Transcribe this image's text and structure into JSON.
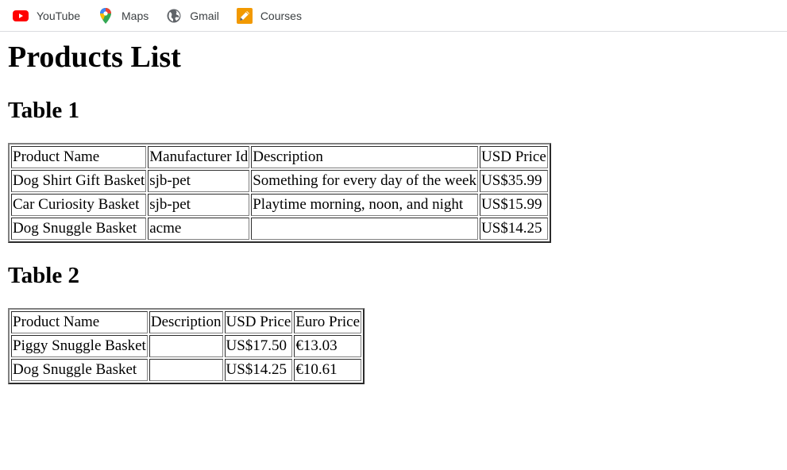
{
  "bookmarks": [
    {
      "label": "YouTube",
      "icon": "youtube-icon"
    },
    {
      "label": "Maps",
      "icon": "maps-icon"
    },
    {
      "label": "Gmail",
      "icon": "globe-icon"
    },
    {
      "label": "Courses",
      "icon": "pencil-icon"
    }
  ],
  "page": {
    "title": "Products List"
  },
  "table1": {
    "heading": "Table 1",
    "headers": [
      "Product Name",
      "Manufacturer Id",
      "Description",
      "USD Price"
    ],
    "rows": [
      [
        "Dog Shirt Gift Basket",
        "sjb-pet",
        "Something for every day of the week",
        "US$35.99"
      ],
      [
        "Car Curiosity Basket",
        "sjb-pet",
        "Playtime morning, noon, and night",
        "US$15.99"
      ],
      [
        "Dog Snuggle Basket",
        "acme",
        "",
        "US$14.25"
      ]
    ]
  },
  "table2": {
    "heading": "Table 2",
    "headers": [
      "Product Name",
      "Description",
      "USD Price",
      "Euro Price"
    ],
    "rows": [
      [
        "Piggy Snuggle Basket",
        "",
        "US$17.50",
        "€13.03"
      ],
      [
        "Dog Snuggle Basket",
        "",
        "US$14.25",
        "€10.61"
      ]
    ]
  },
  "colors": {
    "youtube_red": "#ff0000",
    "maps_green": "#34a853",
    "maps_blue": "#4285f4",
    "maps_red": "#ea4335",
    "maps_yellow": "#fbbc04",
    "globe_gray": "#5f6368",
    "pencil_orange": "#f29900"
  }
}
